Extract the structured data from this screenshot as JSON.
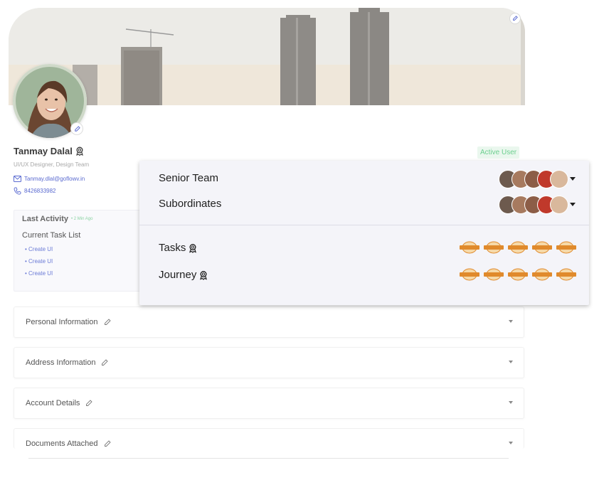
{
  "profile": {
    "name": "Tanmay Dalal",
    "role": "UI/UX Designer, Design Team",
    "email": "Tanmay.dlal@goflowv.in",
    "phone": "8426833982",
    "status": "Active User"
  },
  "activity": {
    "title": "Last Activity",
    "time": "2 Min Ago",
    "task_list_title": "Current Task List",
    "tasks": [
      "Create UI",
      "Create UI",
      "Create UI"
    ]
  },
  "sections": [
    {
      "label": "Personal Information"
    },
    {
      "label": "Address Information"
    },
    {
      "label": "Account Details"
    },
    {
      "label": "Documents Attached"
    }
  ],
  "popup": {
    "senior_team": "Senior Team",
    "subordinates": "Subordinates",
    "tasks": "Tasks",
    "journey": "Journey"
  },
  "colors": {
    "accent": "#5a6ad0",
    "status_text": "#6ccf8e",
    "status_bg": "#eaf7ee",
    "badge_orange": "#e08a2c"
  },
  "icons": [
    "award-icon",
    "mail-icon",
    "phone-icon",
    "pencil-icon",
    "chevron-down-icon"
  ]
}
